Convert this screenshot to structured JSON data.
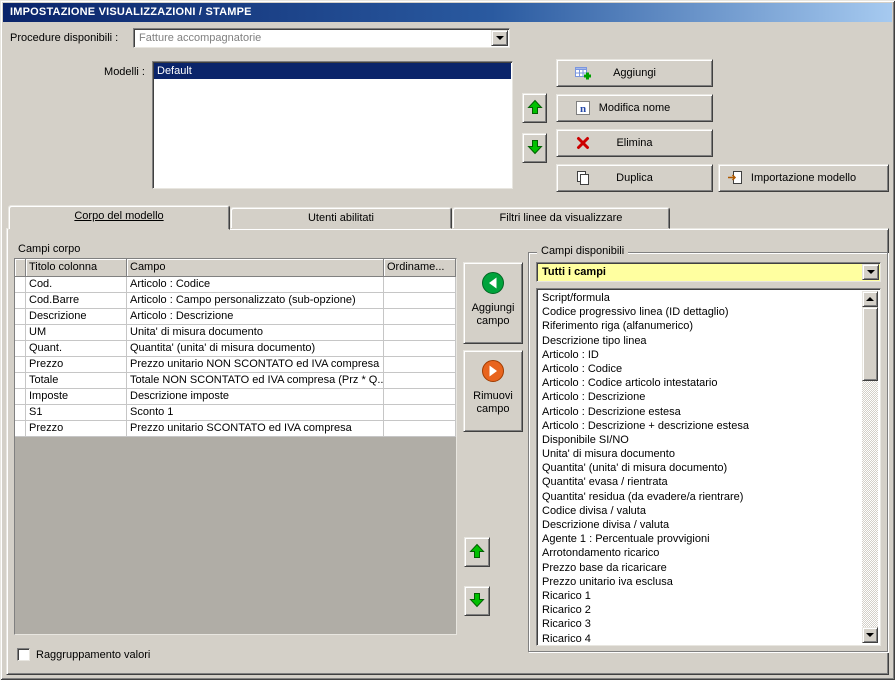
{
  "window": {
    "title": "IMPOSTAZIONE VISUALIZZAZIONI / STAMPE"
  },
  "procedure": {
    "label": "Procedure disponibili :",
    "value": "Fatture accompagnatorie"
  },
  "modelli": {
    "label": "Modelli :",
    "items": [
      "Default"
    ],
    "selected_index": 0
  },
  "model_buttons": {
    "aggiungi": "Aggiungi",
    "modifica_nome": "Modifica nome",
    "elimina": "Elimina",
    "duplica": "Duplica",
    "importazione": "Importazione modello"
  },
  "tabs": {
    "corpo": "Corpo del modello",
    "utenti": "Utenti abilitati",
    "filtri": "Filtri linee da visualizzare"
  },
  "campi_corpo": {
    "label": "Campi corpo",
    "columns": [
      "Titolo colonna",
      "Campo",
      "Ordiname..."
    ],
    "rows": [
      [
        "Cod.",
        "Articolo : Codice",
        ""
      ],
      [
        "Cod.Barre",
        "Articolo : Campo personalizzato (sub-opzione)",
        ""
      ],
      [
        "Descrizione",
        "Articolo : Descrizione",
        ""
      ],
      [
        "UM",
        "Unita' di misura documento",
        ""
      ],
      [
        "Quant.",
        "Quantita' (unita' di misura documento)",
        ""
      ],
      [
        "Prezzo",
        "Prezzo unitario NON SCONTATO ed IVA compresa",
        ""
      ],
      [
        "Totale",
        "Totale NON SCONTATO ed IVA compresa (Prz * Q...",
        ""
      ],
      [
        "Imposte",
        "Descrizione imposte",
        ""
      ],
      [
        "S1",
        "Sconto 1",
        ""
      ],
      [
        "Prezzo",
        "Prezzo unitario SCONTATO ed IVA compresa",
        ""
      ]
    ]
  },
  "field_buttons": {
    "aggiungi": "Aggiungi campo",
    "rimuovi": "Rimuovi campo"
  },
  "campi_disponibili": {
    "label": "Campi disponibili",
    "filter": "Tutti i campi",
    "items": [
      "Script/formula",
      "Codice progressivo linea (ID dettaglio)",
      "Riferimento riga (alfanumerico)",
      "Descrizione tipo linea",
      "Articolo : ID",
      "Articolo : Codice",
      "Articolo : Codice articolo intestatario",
      "Articolo : Descrizione",
      "Articolo : Descrizione estesa",
      "Articolo : Descrizione + descrizione estesa",
      "Disponibile SI/NO",
      "Unita' di misura documento",
      "Quantita' (unita' di misura documento)",
      "Quantita' evasa / rientrata",
      "Quantita' residua (da evadere/a rientrare)",
      "Codice divisa / valuta",
      "Descrizione divisa / valuta",
      "Agente 1 : Percentuale provvigioni",
      "Arrotondamento ricarico",
      "Prezzo base da ricaricare",
      "Prezzo unitario iva esclusa",
      "Ricarico 1",
      "Ricarico 2",
      "Ricarico 3",
      "Ricarico 4"
    ]
  },
  "footer": {
    "raggruppamento": "Raggruppamento valori"
  },
  "colors": {
    "dialog_bg": "#d4d0c8",
    "titlebar_start": "#0a246a",
    "titlebar_end": "#a6caf0",
    "selection": "#0a246a",
    "filter_highlight": "#ffffa0",
    "arrow_green": "#00b400",
    "remove_orange": "#e8641e",
    "delete_red": "#cc0000"
  }
}
